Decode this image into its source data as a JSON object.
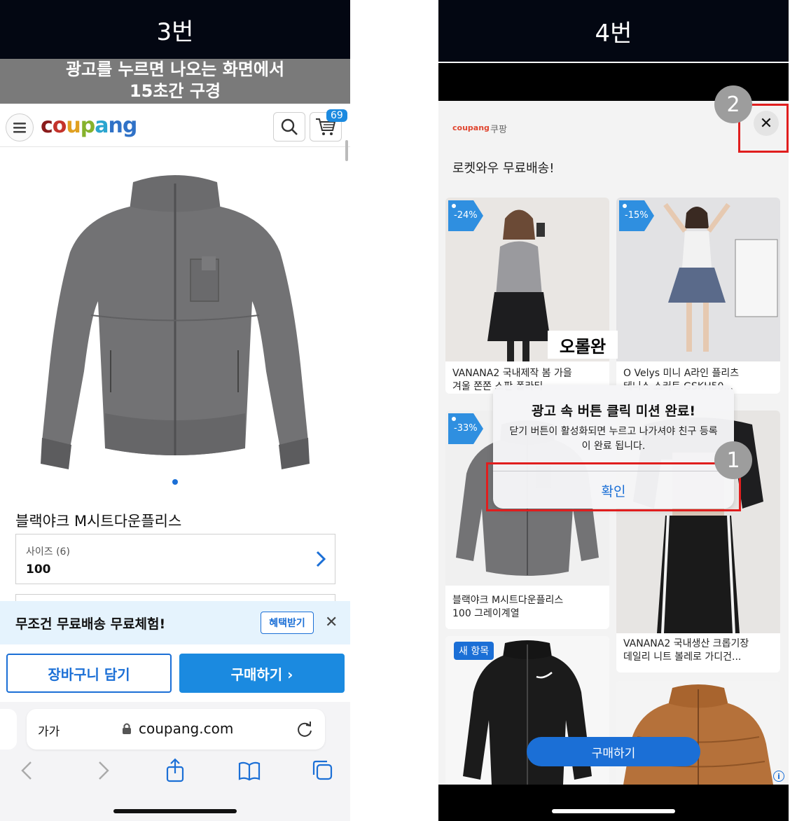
{
  "left_panel": {
    "step_label": "3번",
    "caption_line1": "광고를 누르면 나오는 화면에서",
    "caption_line2": "15초간 구경",
    "logo_text": "coupang",
    "cart_count": "69",
    "product_title": "블랙야크 M시트다운플리스",
    "option_label": "사이즈 (6)",
    "option_value": "100",
    "promo_text": "무조건 무료배송 무료체험!",
    "promo_button": "혜택받기",
    "promo_close": "✕",
    "cart_add_button": "장바구니 담기",
    "buy_button": "구매하기 ›",
    "safari_text_size": "가가",
    "safari_url": "coupang.com"
  },
  "right_panel": {
    "step_label": "4번",
    "ad_brand_logo": "coupang",
    "ad_brand_name": "쿠팡",
    "close_symbol": "✕",
    "headline": "로켓와우 무료배송!",
    "products": [
      {
        "discount": "-24%",
        "caption_line1": "VANANA2 국내제작 봄 가을",
        "caption_line2": "겨울 쫀쫀 스판 폴라티"
      },
      {
        "discount": "-15%",
        "caption_line1": "O Velys 미니 A라인 플리츠",
        "caption_line2": "테니스 스커트 GSKH50..."
      },
      {
        "discount": "-33%",
        "caption_line1": "블랙야크 M시트다운플리스",
        "caption_line2": "100 그레이계열"
      },
      {
        "caption_line1": "VANANA2 국내생산 크롭기장",
        "caption_line2": "데일리 니트 볼레로 가디건..."
      },
      {
        "badge": "새 항목"
      }
    ],
    "overlay_label": "오롤완",
    "dialog": {
      "title": "광고 속 버튼 클릭 미션 완료!",
      "message": "닫기 버튼이 활성화되면 누르고 나가셔야 친구 등록이 완료 됩니다.",
      "confirm": "확인"
    },
    "marker_1": "1",
    "marker_2": "2",
    "float_buy": "구매하기",
    "info_symbol": "i"
  },
  "colors": {
    "coupang_blue": "#1b8ae0",
    "highlight_red": "#e01e1e",
    "marker_gray": "#9d9d9d",
    "header_dark": "#030712"
  }
}
